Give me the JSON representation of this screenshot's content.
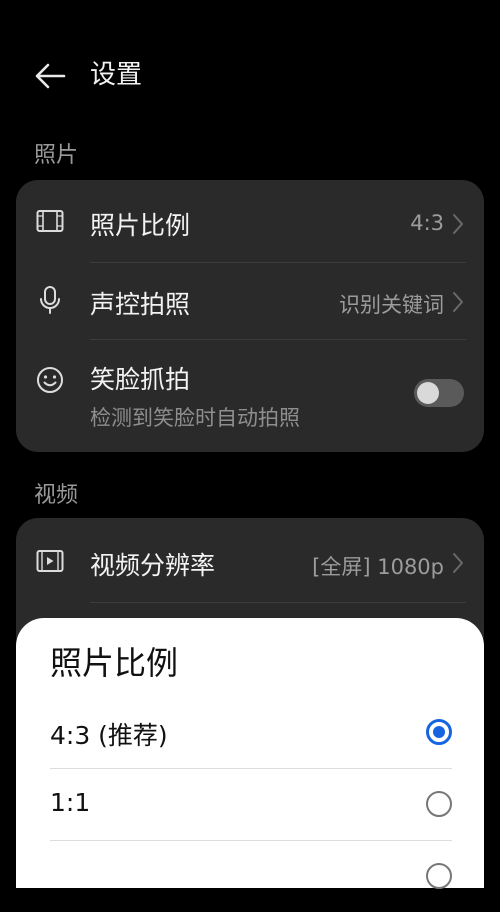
{
  "header": {
    "title": "设置",
    "back_icon": "arrow-left-icon"
  },
  "sections": {
    "photo": {
      "label": "照片",
      "items": [
        {
          "icon": "aspect-ratio-icon",
          "label": "照片比例",
          "value": "4:3",
          "type": "nav"
        },
        {
          "icon": "microphone-icon",
          "label": "声控拍照",
          "value": "识别关键词",
          "type": "nav"
        },
        {
          "icon": "smile-icon",
          "label": "笑脸抓拍",
          "sublabel": "检测到笑脸时自动拍照",
          "type": "toggle",
          "toggle_on": false
        }
      ]
    },
    "video": {
      "label": "视频",
      "items": [
        {
          "icon": "video-resolution-icon",
          "label": "视频分辨率",
          "value": "[全屏] 1080p",
          "type": "nav"
        }
      ]
    }
  },
  "sheet": {
    "title": "照片比例",
    "options": [
      {
        "label": "4:3 (推荐)",
        "selected": true
      },
      {
        "label": "1:1",
        "selected": false
      },
      {
        "label": "",
        "selected": false
      }
    ]
  },
  "colors": {
    "background": "#000000",
    "card": "#2a2a2a",
    "accent": "#1565e0",
    "sheet": "#ffffff"
  }
}
